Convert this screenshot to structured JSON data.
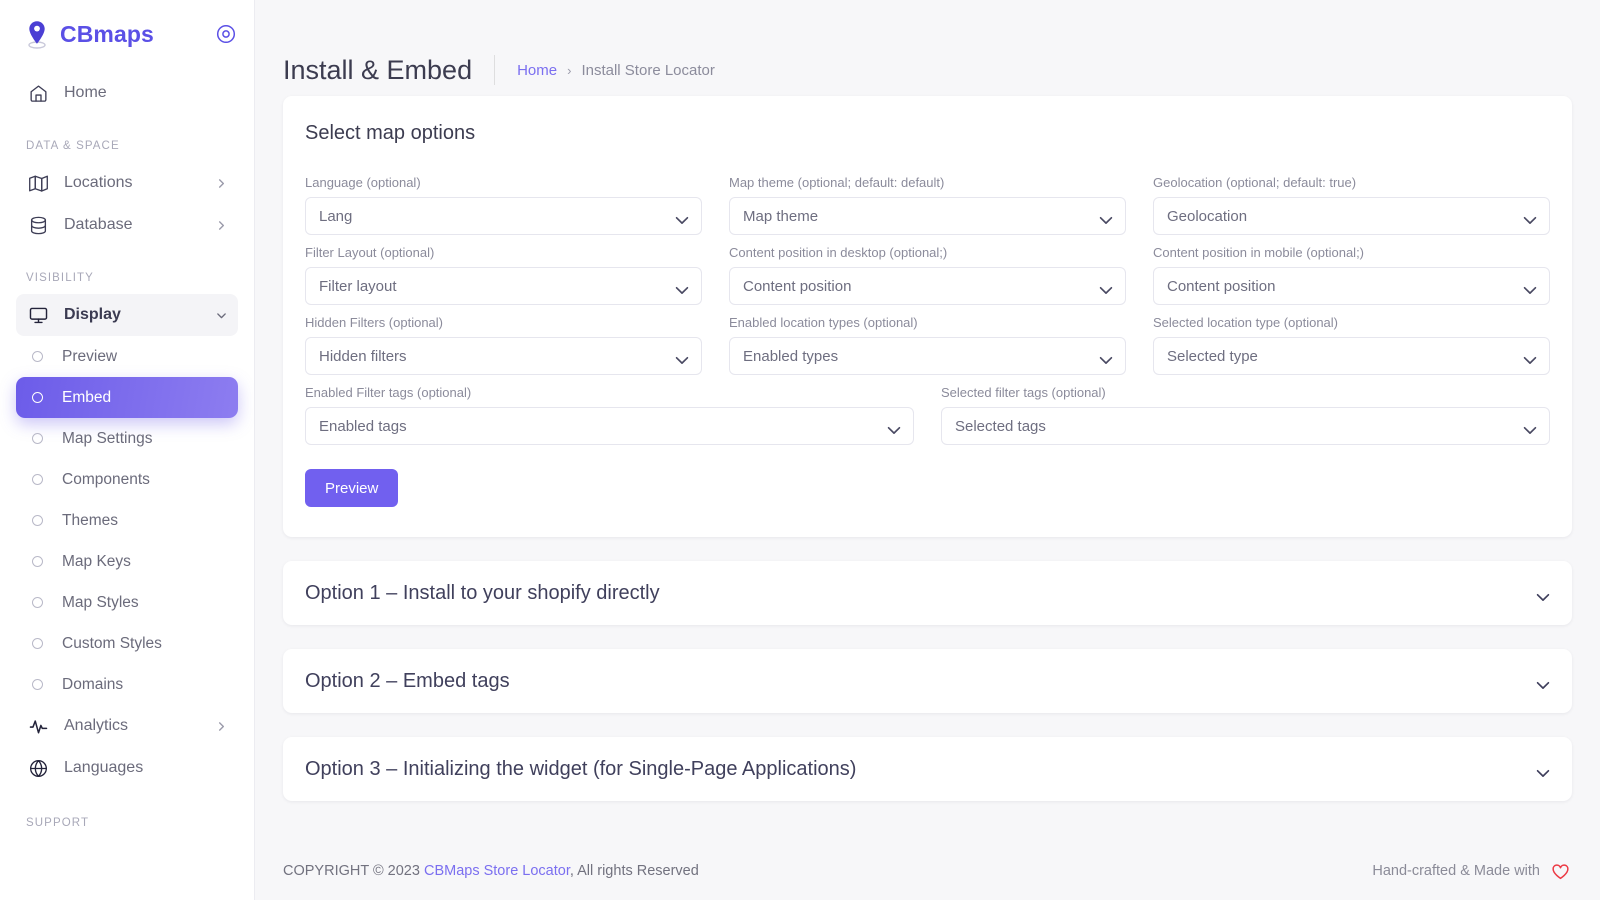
{
  "brand": {
    "name": "CBmaps",
    "logo_icon": "map-pin-icon",
    "toggle_icon": "circle-dot-icon",
    "accent_color": "#5b50e6"
  },
  "sidebar": {
    "top_items": [
      {
        "label": "Home",
        "icon": "home-icon",
        "has_caret": false
      }
    ],
    "sections": [
      {
        "title": "DATA & SPACE",
        "items": [
          {
            "label": "Locations",
            "icon": "map-folded-icon",
            "has_caret": true
          },
          {
            "label": "Database",
            "icon": "database-icon",
            "has_caret": true
          }
        ]
      },
      {
        "title": "VISIBILITY",
        "items": [
          {
            "label": "Display",
            "icon": "monitor-icon",
            "has_caret": true,
            "expanded": true
          }
        ],
        "sub_items": [
          {
            "label": "Preview",
            "active": false
          },
          {
            "label": "Embed",
            "active": true
          },
          {
            "label": "Map Settings",
            "active": false
          },
          {
            "label": "Components",
            "active": false
          },
          {
            "label": "Themes",
            "active": false
          },
          {
            "label": "Map Keys",
            "active": false
          },
          {
            "label": "Map Styles",
            "active": false
          },
          {
            "label": "Custom Styles",
            "active": false
          },
          {
            "label": "Domains",
            "active": false
          }
        ],
        "tail_items": [
          {
            "label": "Analytics",
            "icon": "activity-icon",
            "has_caret": true
          },
          {
            "label": "Languages",
            "icon": "globe-icon",
            "has_caret": false
          }
        ]
      },
      {
        "title": "SUPPORT",
        "items": [],
        "sub_items": [],
        "tail_items": []
      }
    ],
    "active_item_color": "#6c5ce9"
  },
  "header": {
    "title": "Install & Embed",
    "breadcrumb": {
      "home": "Home",
      "separator": "›",
      "current": "Install Store Locator"
    }
  },
  "options_card": {
    "title": "Select map options",
    "fields": [
      {
        "label": "Language (optional)",
        "value": "Lang"
      },
      {
        "label": "Map theme (optional; default: default)",
        "value": "Map theme"
      },
      {
        "label": "Geolocation (optional; default: true)",
        "value": "Geolocation"
      },
      {
        "label": "Filter Layout (optional)",
        "value": "Filter layout"
      },
      {
        "label": "Content position in desktop (optional;)",
        "value": "Content position"
      },
      {
        "label": "Content position in mobile (optional;)",
        "value": "Content position"
      },
      {
        "label": "Hidden Filters (optional)",
        "value": "Hidden filters"
      },
      {
        "label": "Enabled location types (optional)",
        "value": "Enabled types"
      },
      {
        "label": "Selected location type (optional)",
        "value": "Selected type"
      }
    ],
    "wide_fields": [
      {
        "label": "Enabled Filter tags (optional)",
        "value": "Enabled tags"
      },
      {
        "label": "Selected filter tags (optional)",
        "value": "Selected tags"
      }
    ],
    "preview_button": "Preview",
    "preview_button_color": "#7160ef"
  },
  "accordions": [
    {
      "title": "Option 1 – Install to your shopify directly",
      "icon": "chevron-down-icon"
    },
    {
      "title": "Option 2 – Embed tags",
      "icon": "chevron-down-icon"
    },
    {
      "title": "Option 3 – Initializing the widget (for Single-Page Applications)",
      "icon": "chevron-down-icon"
    }
  ],
  "footer": {
    "copyright_prefix": "COPYRIGHT © 2023 ",
    "brand_link": "CBMaps Store Locator",
    "copyright_suffix": ", All rights Reserved",
    "right_text": "Hand-crafted & Made with",
    "heart_icon": "heart-icon",
    "heart_color": "#ec3a45"
  }
}
